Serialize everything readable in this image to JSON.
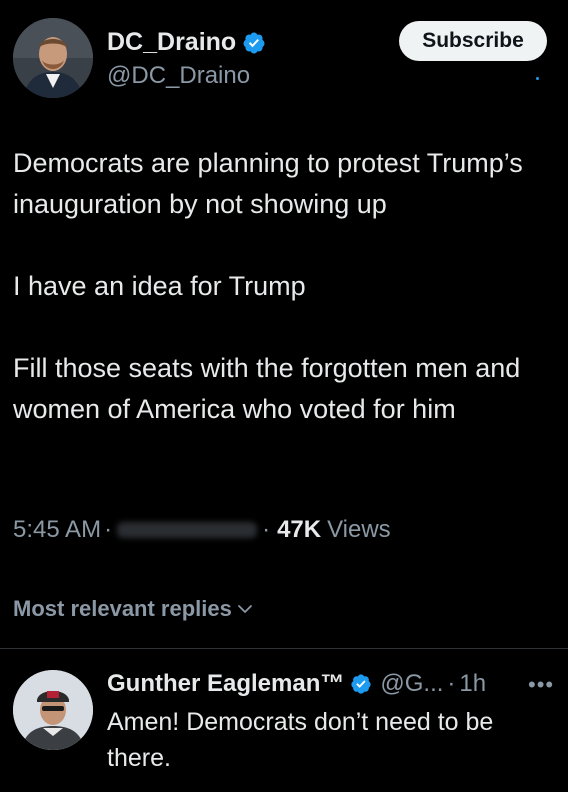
{
  "author": {
    "display_name": "DC_Draino",
    "handle": "@DC_Draino",
    "verified_icon": "verified-badge-icon",
    "avatar_icon": "profile-photo"
  },
  "subscribe_label": "Subscribe",
  "tweet": {
    "text": "Democrats are planning to protest Trump’s inauguration by not showing up\n\nI have an idea for Trump\n\nFill those seats with the forgotten men and women of America who voted for him"
  },
  "meta": {
    "time": "5:45 AM",
    "separator": "·",
    "views_count": "47K",
    "views_label": "Views"
  },
  "replies_filter": {
    "label": "Most relevant replies",
    "icon": "chevron-down-icon"
  },
  "reply": {
    "display_name": "Gunther Eagleman™",
    "handle": "@G...",
    "separator": "·",
    "time": "1h",
    "more_label": "•••",
    "text": "Amen!  Democrats don’t need to be there."
  },
  "colors": {
    "background": "#000000",
    "text_primary": "#e7e9ea",
    "text_secondary": "#8b98a5",
    "verified_blue": "#1d9bf0",
    "subscribe_bg": "#eff3f4",
    "divider": "#2f3336"
  }
}
